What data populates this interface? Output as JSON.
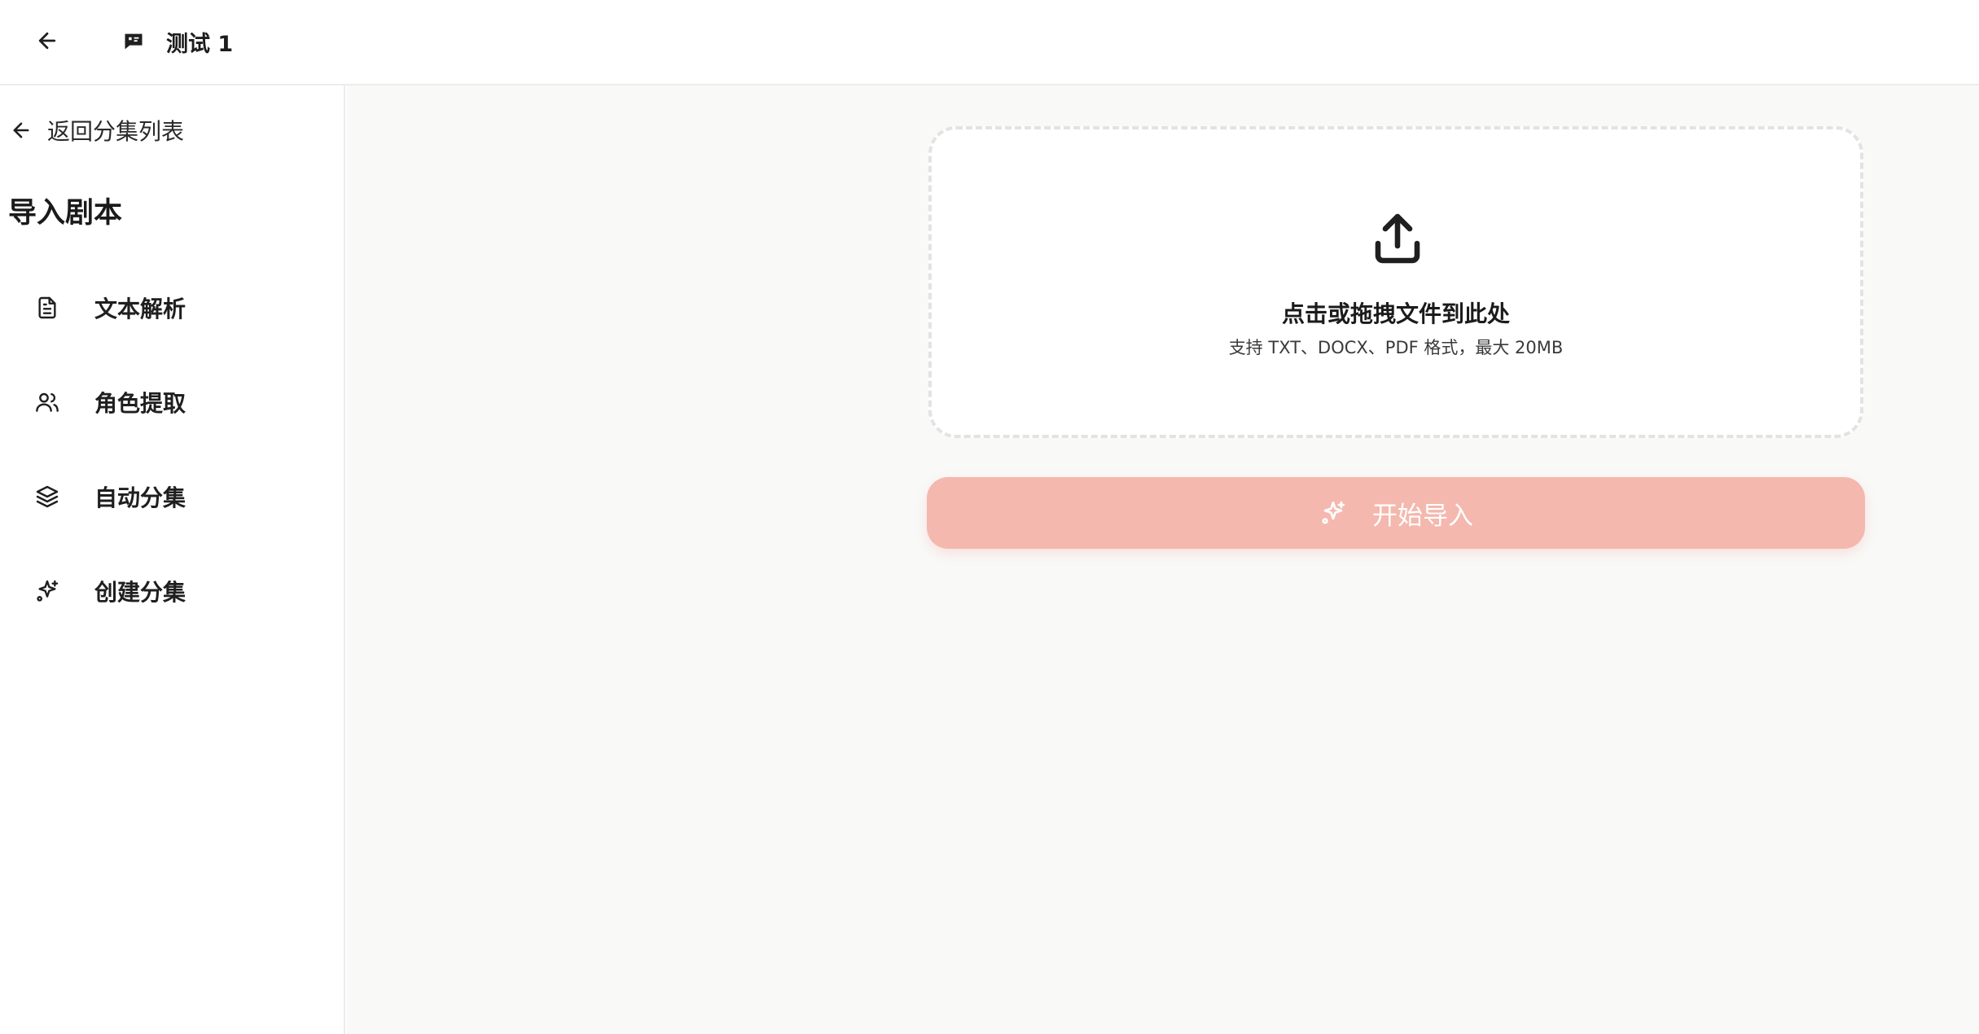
{
  "header": {
    "back_icon": "arrow-left-icon",
    "project_icon": "message-square-icon",
    "project_title": "测试 1"
  },
  "sidebar": {
    "back_label": "返回分集列表",
    "back_icon": "arrow-left-icon",
    "section_title": "导入剧本",
    "items": [
      {
        "label": "文本解析",
        "icon": "file-text-icon"
      },
      {
        "label": "角色提取",
        "icon": "users-icon"
      },
      {
        "label": "自动分集",
        "icon": "layers-icon"
      },
      {
        "label": "创建分集",
        "icon": "sparkles-icon"
      }
    ]
  },
  "main": {
    "upload": {
      "icon": "upload-icon",
      "title": "点击或拖拽文件到此处",
      "hint": "支持 TXT、DOCX、PDF 格式，最大 20MB"
    },
    "import_button": {
      "label": "开始导入",
      "icon": "sparkles-icon",
      "color": "#f4b8ae"
    }
  }
}
